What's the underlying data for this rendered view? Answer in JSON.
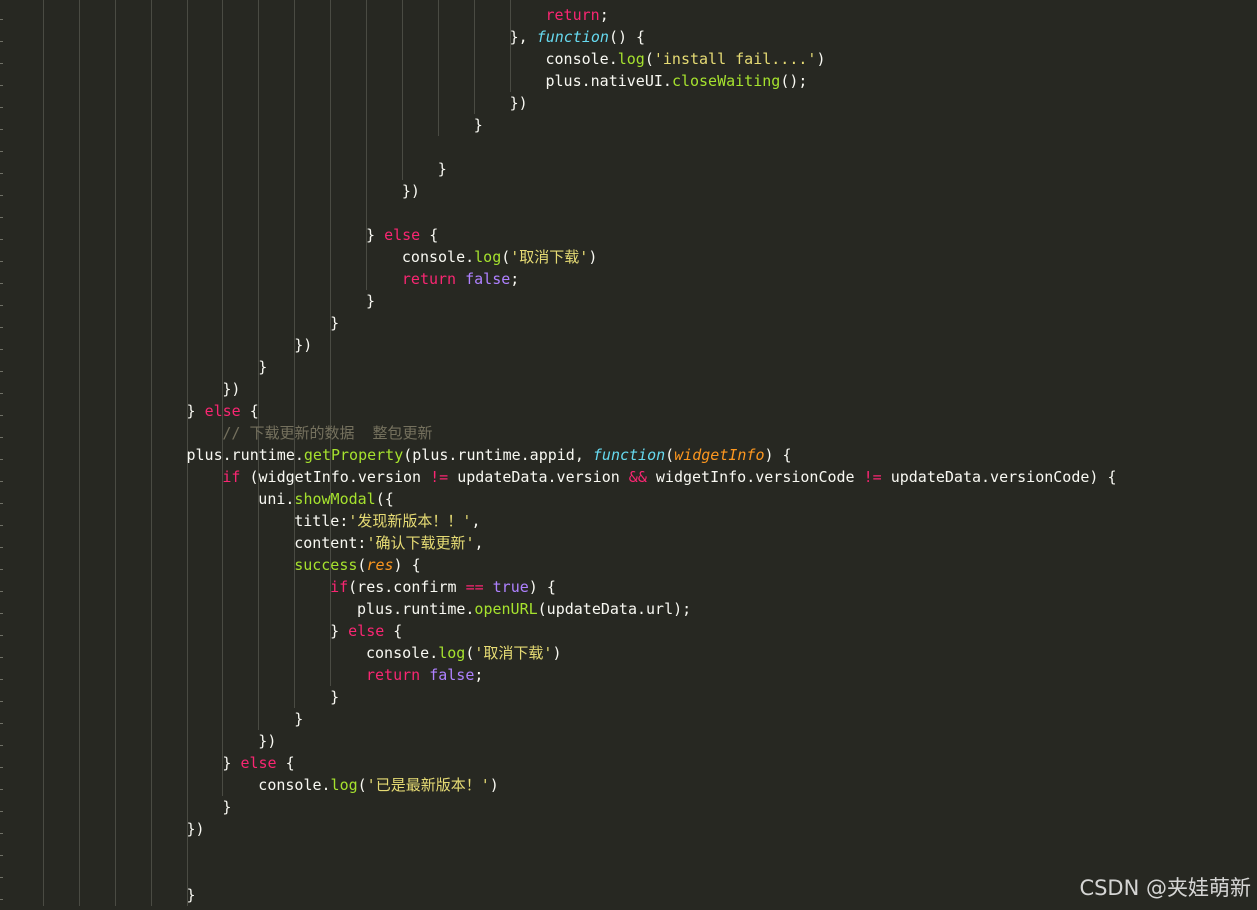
{
  "theme": {
    "background": "#272822",
    "default": "#f8f8f2",
    "keyword": "#f92672",
    "function": "#a6e22e",
    "string": "#e6db74",
    "storage": "#66d9ef",
    "parameter": "#fd971f",
    "constant": "#ae81ff",
    "comment": "#75715e"
  },
  "watermark": "CSDN @夹娃萌新",
  "code_lines": [
    {
      "indent": 15,
      "tokens": [
        [
          "kw",
          "return"
        ],
        [
          "p",
          ";"
        ]
      ]
    },
    {
      "indent": 14,
      "tokens": [
        [
          "p",
          "}, "
        ],
        [
          "st",
          "function"
        ],
        [
          "p",
          "() {"
        ]
      ]
    },
    {
      "indent": 15,
      "tokens": [
        [
          "p",
          "console."
        ],
        [
          "fn",
          "log"
        ],
        [
          "p",
          "("
        ],
        [
          "s",
          "'install fail....'"
        ],
        [
          "p",
          ")"
        ]
      ]
    },
    {
      "indent": 15,
      "tokens": [
        [
          "p",
          "plus.nativeUI."
        ],
        [
          "fn",
          "closeWaiting"
        ],
        [
          "p",
          "();"
        ]
      ]
    },
    {
      "indent": 14,
      "tokens": [
        [
          "p",
          "})"
        ]
      ]
    },
    {
      "indent": 13,
      "tokens": [
        [
          "p",
          "}"
        ]
      ]
    },
    {
      "indent": 0,
      "tokens": []
    },
    {
      "indent": 12,
      "tokens": [
        [
          "p",
          "}"
        ]
      ]
    },
    {
      "indent": 11,
      "tokens": [
        [
          "p",
          "})"
        ]
      ]
    },
    {
      "indent": 0,
      "tokens": []
    },
    {
      "indent": 10,
      "tokens": [
        [
          "p",
          "} "
        ],
        [
          "kw",
          "else"
        ],
        [
          "p",
          " {"
        ]
      ]
    },
    {
      "indent": 11,
      "tokens": [
        [
          "p",
          "console."
        ],
        [
          "fn",
          "log"
        ],
        [
          "p",
          "("
        ],
        [
          "s",
          "'取消下载'"
        ],
        [
          "p",
          ")"
        ]
      ]
    },
    {
      "indent": 11,
      "tokens": [
        [
          "kw",
          "return"
        ],
        [
          "p",
          " "
        ],
        [
          "c",
          "false"
        ],
        [
          "p",
          ";"
        ]
      ]
    },
    {
      "indent": 10,
      "tokens": [
        [
          "p",
          "}"
        ]
      ]
    },
    {
      "indent": 9,
      "tokens": [
        [
          "p",
          "}"
        ]
      ]
    },
    {
      "indent": 8,
      "tokens": [
        [
          "p",
          "})"
        ]
      ]
    },
    {
      "indent": 7,
      "tokens": [
        [
          "p",
          "}"
        ]
      ]
    },
    {
      "indent": 6,
      "tokens": [
        [
          "p",
          "})"
        ]
      ]
    },
    {
      "indent": 5,
      "tokens": [
        [
          "p",
          "} "
        ],
        [
          "kw",
          "else"
        ],
        [
          "p",
          " {"
        ]
      ]
    },
    {
      "indent": 6,
      "tokens": [
        [
          "cm",
          "// 下载更新的数据  整包更新"
        ]
      ]
    },
    {
      "indent": 5,
      "tokens": [
        [
          "p",
          "plus.runtime."
        ],
        [
          "fn",
          "getProperty"
        ],
        [
          "p",
          "(plus.runtime.appid, "
        ],
        [
          "st",
          "function"
        ],
        [
          "p",
          "("
        ],
        [
          "pa",
          "widgetInfo"
        ],
        [
          "p",
          ") {"
        ]
      ]
    },
    {
      "indent": 6,
      "tokens": [
        [
          "kw",
          "if"
        ],
        [
          "p",
          " (widgetInfo.version "
        ],
        [
          "kw",
          "!="
        ],
        [
          "p",
          " updateData.version "
        ],
        [
          "kw",
          "&&"
        ],
        [
          "p",
          " widgetInfo.versionCode "
        ],
        [
          "kw",
          "!="
        ],
        [
          "p",
          " updateData.versionCode) {"
        ]
      ]
    },
    {
      "indent": 7,
      "tokens": [
        [
          "p",
          "uni."
        ],
        [
          "fn",
          "showModal"
        ],
        [
          "p",
          "({"
        ]
      ]
    },
    {
      "indent": 8,
      "tokens": [
        [
          "p",
          "title:"
        ],
        [
          "s",
          "'发现新版本！！'"
        ],
        [
          "p",
          ","
        ]
      ]
    },
    {
      "indent": 8,
      "tokens": [
        [
          "p",
          "content:"
        ],
        [
          "s",
          "'确认下载更新'"
        ],
        [
          "p",
          ","
        ]
      ]
    },
    {
      "indent": 8,
      "tokens": [
        [
          "fn",
          "success"
        ],
        [
          "p",
          "("
        ],
        [
          "pa",
          "res"
        ],
        [
          "p",
          ") {"
        ]
      ]
    },
    {
      "indent": 9,
      "tokens": [
        [
          "kw",
          "if"
        ],
        [
          "p",
          "(res.confirm "
        ],
        [
          "kw",
          "=="
        ],
        [
          "p",
          " "
        ],
        [
          "c",
          "true"
        ],
        [
          "p",
          ") {"
        ]
      ]
    },
    {
      "indent": 9.75,
      "tokens": [
        [
          "p",
          "plus.runtime."
        ],
        [
          "fn",
          "openURL"
        ],
        [
          "p",
          "(updateData.url);"
        ]
      ]
    },
    {
      "indent": 9,
      "tokens": [
        [
          "p",
          "} "
        ],
        [
          "kw",
          "else"
        ],
        [
          "p",
          " {"
        ]
      ]
    },
    {
      "indent": 10,
      "tokens": [
        [
          "p",
          "console."
        ],
        [
          "fn",
          "log"
        ],
        [
          "p",
          "("
        ],
        [
          "s",
          "'取消下载'"
        ],
        [
          "p",
          ")"
        ]
      ]
    },
    {
      "indent": 10,
      "tokens": [
        [
          "kw",
          "return"
        ],
        [
          "p",
          " "
        ],
        [
          "c",
          "false"
        ],
        [
          "p",
          ";"
        ]
      ]
    },
    {
      "indent": 9,
      "tokens": [
        [
          "p",
          "}"
        ]
      ]
    },
    {
      "indent": 8,
      "tokens": [
        [
          "p",
          "}"
        ]
      ]
    },
    {
      "indent": 7,
      "tokens": [
        [
          "p",
          "})"
        ]
      ]
    },
    {
      "indent": 6,
      "tokens": [
        [
          "p",
          "} "
        ],
        [
          "kw",
          "else"
        ],
        [
          "p",
          " {"
        ]
      ]
    },
    {
      "indent": 7,
      "tokens": [
        [
          "p",
          "console."
        ],
        [
          "fn",
          "log"
        ],
        [
          "p",
          "("
        ],
        [
          "s",
          "'已是最新版本！'"
        ],
        [
          "p",
          ")"
        ]
      ]
    },
    {
      "indent": 6,
      "tokens": [
        [
          "p",
          "}"
        ]
      ]
    },
    {
      "indent": 5,
      "tokens": [
        [
          "p",
          "})"
        ]
      ]
    },
    {
      "indent": 0,
      "tokens": []
    },
    {
      "indent": 0,
      "tokens": []
    },
    {
      "indent": 5,
      "tokens": [
        [
          "p",
          "}"
        ]
      ]
    }
  ]
}
